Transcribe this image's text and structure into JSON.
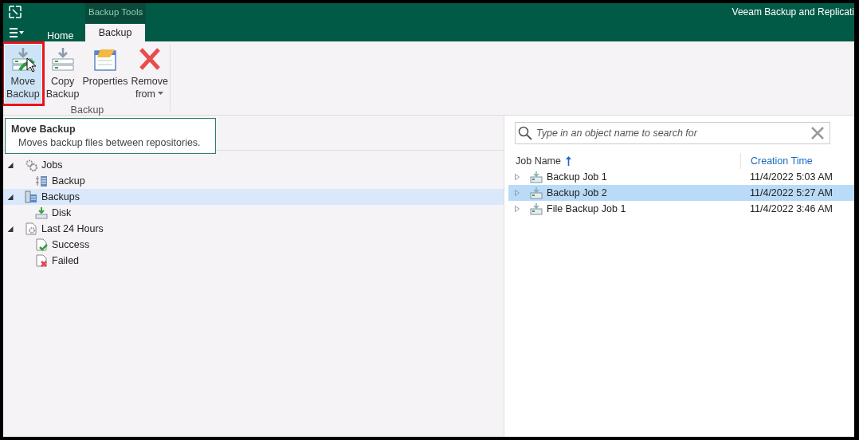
{
  "window": {
    "title": "Veeam Backup and Replicati",
    "context_tab": "Backup Tools"
  },
  "tabs": [
    {
      "label": "Home",
      "selected": false
    },
    {
      "label": "Backup",
      "selected": true
    }
  ],
  "ribbon": {
    "groups": [
      {
        "label": "Backup",
        "buttons": [
          {
            "kind": "move",
            "lines": [
              "Move",
              "Backup"
            ],
            "highlighted": true,
            "dropdown": false
          },
          {
            "kind": "copy",
            "lines": [
              "Copy",
              "Backup"
            ],
            "highlighted": false,
            "dropdown": false
          },
          {
            "kind": "properties",
            "lines": [
              "Properties"
            ],
            "highlighted": false,
            "dropdown": false
          },
          {
            "kind": "remove",
            "lines": [
              "Remove",
              "from"
            ],
            "highlighted": false,
            "dropdown": true
          }
        ]
      }
    ]
  },
  "tooltip": {
    "title": "Move Backup",
    "text": "Moves backup files between repositories."
  },
  "tree": [
    {
      "label": "Jobs",
      "kind": "jobs",
      "expanded": true,
      "selected": false,
      "children": [
        {
          "label": "Backup",
          "kind": "job",
          "selected": false
        }
      ]
    },
    {
      "label": "Backups",
      "kind": "backups",
      "expanded": true,
      "selected": true,
      "children": [
        {
          "label": "Disk",
          "kind": "disk",
          "selected": false
        }
      ]
    },
    {
      "label": "Last 24 Hours",
      "kind": "sessions",
      "expanded": true,
      "selected": false,
      "children": [
        {
          "label": "Success",
          "kind": "success",
          "selected": false
        },
        {
          "label": "Failed",
          "kind": "failed",
          "selected": false
        }
      ]
    }
  ],
  "search": {
    "placeholder": "Type in an object name to search for"
  },
  "table": {
    "columns": [
      {
        "label": "Job Name",
        "sorted": true
      },
      {
        "label": "Creation Time",
        "sorted": false
      }
    ],
    "rows": [
      {
        "cells": [
          "Backup Job 1",
          "11/4/2022 5:03 AM"
        ],
        "selected": false
      },
      {
        "cells": [
          "Backup Job 2",
          "11/4/2022 5:27 AM"
        ],
        "selected": true
      },
      {
        "cells": [
          "File Backup Job 1",
          "11/4/2022 3:46 AM"
        ],
        "selected": false
      }
    ]
  }
}
